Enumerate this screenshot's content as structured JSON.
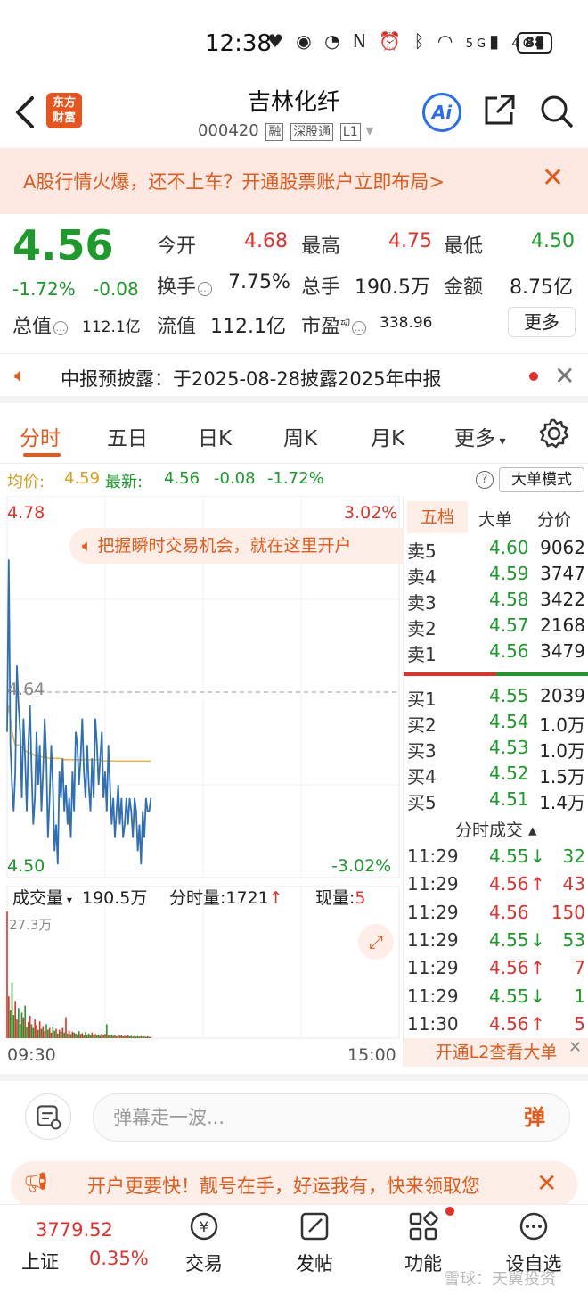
{
  "status_bar": {
    "time": "12:38",
    "battery": "88",
    "signal_5g": "5G",
    "signal_4g": "4G"
  },
  "header": {
    "logo_line1": "东方",
    "logo_line2": "财富",
    "stock_name": "吉林化纤",
    "stock_code": "000420",
    "tags": [
      "融",
      "深股通",
      "L1"
    ],
    "ai_label": "Ai"
  },
  "banner": {
    "text": "A股行情火爆，还不上车？开通股票账户立即布局>"
  },
  "quote": {
    "price": "4.56",
    "change_pct": "-1.72%",
    "change_abs": "-0.08",
    "open_label": "今开",
    "open": "4.68",
    "high_label": "最高",
    "high": "4.75",
    "low_label": "最低",
    "low": "4.50",
    "turnover_label": "换手",
    "turnover": "7.75%",
    "volume_label": "总手",
    "volume": "190.5万",
    "amount_label": "金额",
    "amount": "8.75亿",
    "mktcap_label": "总值",
    "mktcap": "112.1亿",
    "float_label": "流值",
    "float_cap": "112.1亿",
    "pe_label": "市盈",
    "pe_sup": "动",
    "pe": "338.96",
    "more_label": "更多"
  },
  "notice": {
    "text": "中报预披露：于2025-08-28披露2025年中报"
  },
  "tabs": [
    "分时",
    "五日",
    "日K",
    "周K",
    "月K",
    "更多"
  ],
  "avg_bar": {
    "avg_label": "均价:",
    "avg_value": "4.59",
    "latest_label": "最新:",
    "latest_value": "4.56",
    "change_abs": "-0.08",
    "change_pct": "-1.72%",
    "mode_label": "大单模式"
  },
  "chart_data": {
    "type": "line",
    "title": "",
    "y_top_label": "4.78",
    "y_mid_label": "4.64",
    "y_bottom_label": "4.50",
    "pct_top_label": "3.02%",
    "pct_bottom_label": "-3.02%",
    "ylim": [
      4.5,
      4.78
    ],
    "prev_close": 4.64,
    "x_start_label": "09:30",
    "x_end_label": "15:00",
    "series": [
      {
        "name": "",
        "values": [
          4.61,
          4.74,
          4.6,
          4.57,
          4.55,
          4.58,
          4.66,
          4.63,
          4.61,
          4.56,
          4.62,
          4.59,
          4.55,
          4.6,
          4.63,
          4.58,
          4.54,
          4.56,
          4.61,
          4.57,
          4.6,
          4.55,
          4.58,
          4.62,
          4.59,
          4.53,
          4.56,
          4.6,
          4.57,
          4.52,
          4.54,
          4.51,
          4.58,
          4.56,
          4.59,
          4.55,
          4.57,
          4.54,
          4.56,
          4.53,
          4.58,
          4.55,
          4.61,
          4.6,
          4.57,
          4.59,
          4.62,
          4.58,
          4.56,
          4.6,
          4.57,
          4.55,
          4.59,
          4.56,
          4.62,
          4.6,
          4.57,
          4.59,
          4.61,
          4.56,
          4.58,
          4.55,
          4.6,
          4.57,
          4.54,
          4.56,
          4.53,
          4.55,
          4.57,
          4.54,
          4.56,
          4.53,
          4.54,
          4.56,
          4.54,
          4.56,
          4.55,
          4.53,
          4.56,
          4.55,
          4.52,
          4.54,
          4.51,
          4.55,
          4.53,
          4.56,
          4.55,
          4.55,
          4.56
        ]
      },
      {
        "name": "",
        "values": [
          4.62,
          4.63,
          4.62,
          4.61,
          4.605,
          4.6,
          4.6,
          4.6,
          4.6,
          4.598,
          4.597,
          4.596,
          4.595,
          4.594,
          4.594,
          4.594,
          4.593,
          4.592,
          4.592,
          4.592,
          4.592,
          4.591,
          4.591,
          4.591,
          4.591,
          4.59,
          4.59,
          4.59,
          4.59,
          4.59,
          4.59,
          4.59,
          4.59,
          4.59,
          4.589,
          4.589,
          4.589,
          4.589,
          4.589,
          4.589,
          4.589,
          4.589,
          4.589,
          4.589,
          4.589,
          4.589,
          4.589,
          4.589,
          4.589,
          4.589,
          4.589,
          4.589,
          4.589,
          4.589,
          4.589,
          4.589,
          4.589,
          4.589,
          4.588,
          4.588,
          4.588,
          4.588,
          4.588,
          4.588,
          4.588,
          4.588,
          4.588,
          4.588,
          4.588,
          4.588,
          4.588,
          4.588,
          4.588,
          4.588,
          4.588,
          4.588,
          4.588,
          4.588,
          4.588,
          4.588,
          4.588,
          4.588,
          4.588,
          4.588,
          4.588,
          4.588,
          4.588,
          4.588,
          4.588
        ]
      }
    ],
    "volume": {
      "head_label": "成交量",
      "total": "190.5万",
      "minute_label": "分时量:1721",
      "current_label": "现量:",
      "current": "5",
      "max_label": "27.3万",
      "ylim": [
        0,
        273000
      ],
      "values": [
        273000,
        90000,
        60000,
        120000,
        50000,
        80000,
        40000,
        65000,
        30000,
        55000,
        45000,
        70000,
        25000,
        35000,
        48000,
        30000,
        22000,
        40000,
        28000,
        18000,
        36000,
        20000,
        26000,
        15000,
        30000,
        18000,
        22000,
        12000,
        25000,
        16000,
        20000,
        10000,
        18000,
        14000,
        22000,
        12000,
        45000,
        10000,
        16000,
        9000,
        14000,
        12000,
        10000,
        8000,
        15000,
        9000,
        11000,
        7000,
        13000,
        8000,
        10000,
        6000,
        12000,
        7000,
        9000,
        6000,
        8000,
        5000,
        10000,
        6000,
        9000,
        30000,
        7000,
        5000,
        8000,
        5000,
        7000,
        4000,
        6000,
        5000,
        7000,
        4000,
        5000,
        4000,
        6000,
        4000,
        5000,
        3500,
        5000,
        3500,
        4500,
        3000,
        4500,
        3000,
        4000,
        3000,
        4000,
        2500,
        3000
      ]
    }
  },
  "order_book": {
    "tabs": [
      "五档",
      "大单",
      "分价"
    ],
    "asks": [
      {
        "label": "卖5",
        "price": "4.60",
        "vol": "9062"
      },
      {
        "label": "卖4",
        "price": "4.59",
        "vol": "3747"
      },
      {
        "label": "卖3",
        "price": "4.58",
        "vol": "3422"
      },
      {
        "label": "卖2",
        "price": "4.57",
        "vol": "2168"
      },
      {
        "label": "卖1",
        "price": "4.56",
        "vol": "3479"
      }
    ],
    "bids": [
      {
        "label": "买1",
        "price": "4.55",
        "vol": "2039"
      },
      {
        "label": "买2",
        "price": "4.54",
        "vol": "1.0万"
      },
      {
        "label": "买3",
        "price": "4.53",
        "vol": "1.0万"
      },
      {
        "label": "买4",
        "price": "4.52",
        "vol": "1.5万"
      },
      {
        "label": "买5",
        "price": "4.51",
        "vol": "1.4万"
      }
    ],
    "trades_label": "分时成交",
    "trades": [
      {
        "time": "11:29",
        "price": "4.55",
        "dir": "↓",
        "vol": "32"
      },
      {
        "time": "11:29",
        "price": "4.56",
        "dir": "↑",
        "vol": "43"
      },
      {
        "time": "11:29",
        "price": "4.56",
        "dir": "",
        "vol": "150"
      },
      {
        "time": "11:29",
        "price": "4.55",
        "dir": "↓",
        "vol": "53"
      },
      {
        "time": "11:29",
        "price": "4.56",
        "dir": "↑",
        "vol": "7"
      },
      {
        "time": "11:29",
        "price": "4.55",
        "dir": "↓",
        "vol": "1"
      },
      {
        "time": "11:30",
        "price": "4.56",
        "dir": "↑",
        "vol": "5"
      }
    ],
    "l2_label": "开通L2查看大单"
  },
  "promo_chip": "把握瞬时交易机会，就在这里开户",
  "danmaku": {
    "placeholder": "弹幕走一波...",
    "send_label": "弹"
  },
  "bottom_promo": {
    "text": "开户更要快！靓号在手，好运我有，快来领取您"
  },
  "bottom_nav": {
    "index_value": "3779.52",
    "index_name": "上证",
    "index_change": "0.35%",
    "items": [
      "交易",
      "发帖",
      "功能",
      "设自选"
    ]
  },
  "watermark": "雪球：天翼投资"
}
